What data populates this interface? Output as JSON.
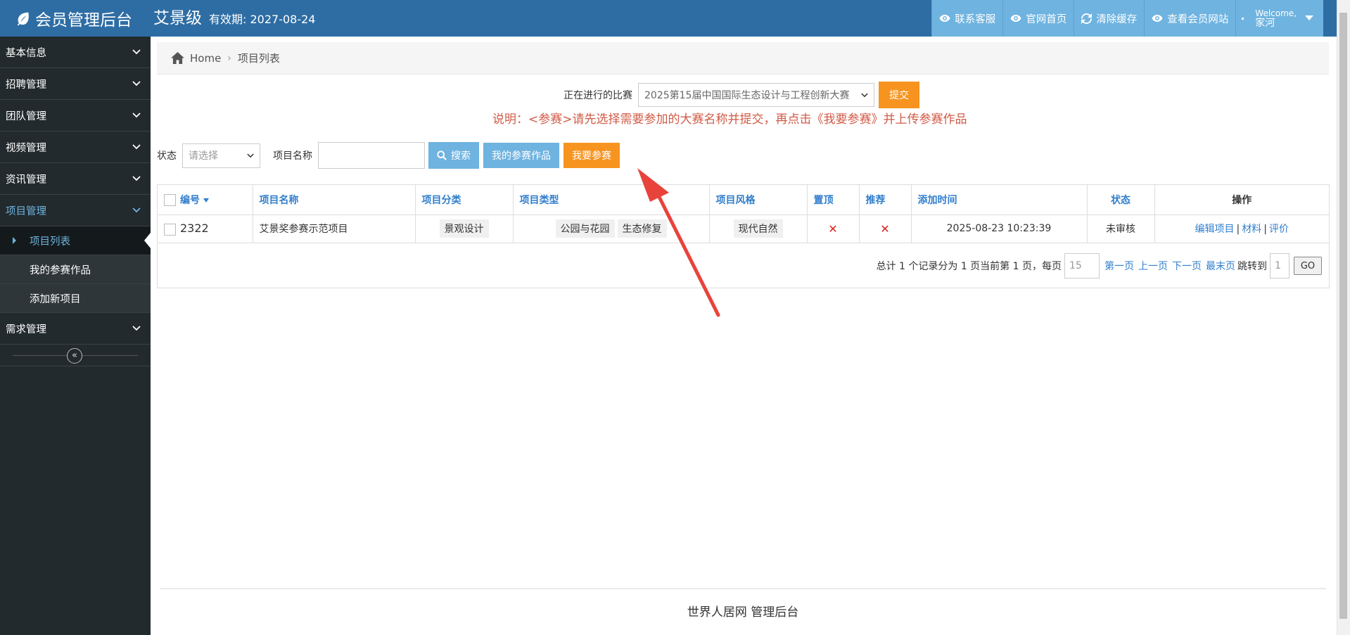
{
  "header": {
    "brand": "会员管理后台",
    "member_level": "艾景级",
    "expiry": "有效期: 2027-08-24",
    "nav": [
      {
        "label": "联系客服",
        "icon": "eye-icon"
      },
      {
        "label": "官网首页",
        "icon": "eye-icon"
      },
      {
        "label": "清除缓存",
        "icon": "refresh-icon"
      },
      {
        "label": "查看会员网站",
        "icon": "eye-icon"
      }
    ],
    "welcome": "Welcome,",
    "username": "家河"
  },
  "sidebar": {
    "items": [
      {
        "label": "基本信息"
      },
      {
        "label": "招聘管理"
      },
      {
        "label": "团队管理"
      },
      {
        "label": "视频管理"
      },
      {
        "label": "资讯管理"
      },
      {
        "label": "项目管理"
      }
    ],
    "sub_items": [
      {
        "label": "项目列表"
      },
      {
        "label": "我的参赛作品"
      },
      {
        "label": "添加新项目"
      }
    ],
    "after_items": [
      {
        "label": "需求管理"
      }
    ]
  },
  "breadcrumb": {
    "home": "Home",
    "current": "项目列表"
  },
  "competition": {
    "label": "正在进行的比赛",
    "selected": "2025第15届中国国际生态设计与工程创新大赛",
    "submit": "提交",
    "notice": "说明：<参赛>请先选择需要参加的大赛名称并提交，再点击《我要参赛》并上传参赛作品"
  },
  "filters": {
    "status_label": "状态",
    "status_placeholder": "请选择",
    "name_label": "项目名称",
    "search": "搜索",
    "my_entries": "我的参赛作品",
    "join": "我要参赛"
  },
  "table": {
    "headers": {
      "id": "编号",
      "name": "项目名称",
      "category": "项目分类",
      "type": "项目类型",
      "style": "项目风格",
      "top": "置顶",
      "recommend": "推荐",
      "added": "添加时间",
      "status": "状态",
      "ops": "操作"
    },
    "rows": [
      {
        "id": "2322",
        "name": "艾景奖参赛示范项目",
        "category": "景观设计",
        "type1": "公园与花园",
        "type2": "生态修复",
        "style": "现代自然",
        "top": "✕",
        "recommend": "✕",
        "added": "2025-08-23 10:23:39",
        "status": "未审核",
        "edit": "编辑项目",
        "materials": "材料",
        "review": "评价",
        "sep": "|"
      }
    ]
  },
  "pager": {
    "summary": "总计 1 个记录分为 1 页当前第 1 页，每页",
    "per_page": "15",
    "first": "第一页",
    "prev": "上一页",
    "next": "下一页",
    "last": "最末页",
    "jump_label": "跳转到",
    "jump_value": "1",
    "go": "GO"
  },
  "footer": {
    "text": "世界人居网 管理后台"
  },
  "colors": {
    "header": "#2e6da4",
    "nav_button": "#6fb3e0",
    "sidebar": "#222a2d",
    "orange": "#f79420",
    "notice_red": "#d15b47",
    "link_blue": "#307ecc",
    "arrow_red": "#e8433a"
  }
}
